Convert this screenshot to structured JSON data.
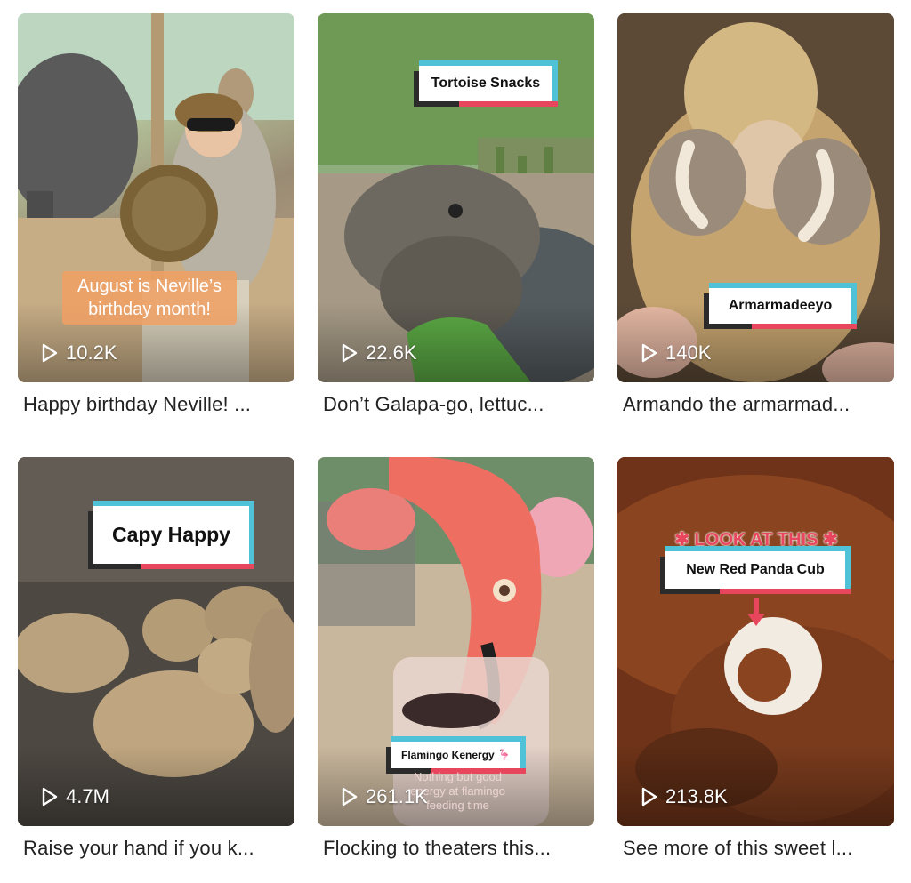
{
  "videos": [
    {
      "views": "10.2K",
      "caption": "Happy birthday Neville! ...",
      "overlay": "August is Neville’s birthday month!"
    },
    {
      "views": "22.6K",
      "caption": "Don’t Galapa-go, lettuc...",
      "sticker": "Tortoise Snacks"
    },
    {
      "views": "140K",
      "caption": "Armando the armarmad...",
      "sticker": "Armarmadeeyo"
    },
    {
      "views": "4.7M",
      "caption": "Raise your hand if you k...",
      "sticker": "Capy Happy"
    },
    {
      "views": "261.1K",
      "caption": "Flocking to theaters this...",
      "sticker": "Flamingo Kenergy 🦩",
      "subtext": "Nothing but good energy at flamingo feeding time"
    },
    {
      "views": "213.8K",
      "caption": "See more of this sweet l...",
      "banner": "LOOK AT THIS",
      "sticker": "New Red Panda Cub"
    }
  ],
  "icons": {
    "views": "play-icon"
  },
  "colors": {
    "sticker_teal": "#4fc2d8",
    "sticker_red": "#e8465c",
    "banner_red": "#e8465c"
  }
}
